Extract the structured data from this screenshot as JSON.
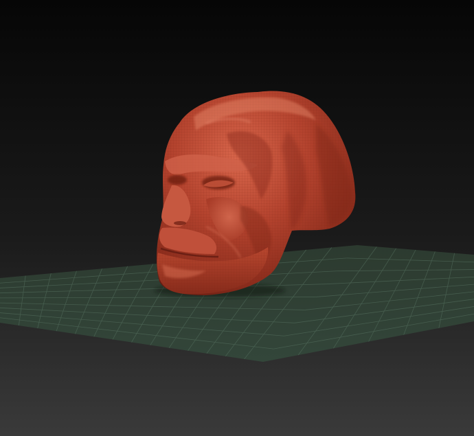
{
  "viewport": {
    "background_top": "#060606",
    "background_bottom": "#3a3a3a",
    "floor_color": "#2e3d31",
    "floor_grid_color": "#51695a",
    "model_color": "#b4432e",
    "model_highlight": "#e07a5f",
    "model_shadow": "#5e1a10",
    "model_name": "skull-sculpt"
  }
}
